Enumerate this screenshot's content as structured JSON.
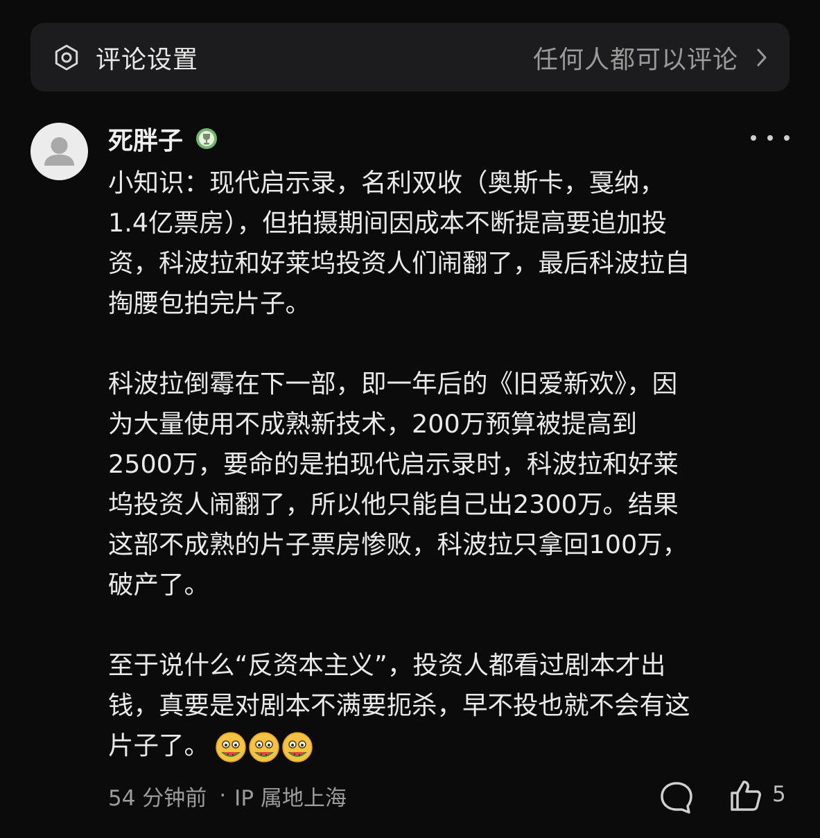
{
  "settings": {
    "icon": "settings-gear-icon",
    "label": "评论设置",
    "value": "任何人都可以评论",
    "chevron_icon": "chevron-right-icon"
  },
  "comment": {
    "avatar_icon": "default-user-avatar",
    "username": "死胖子",
    "badge_icon": "trophy-badge-icon",
    "more_icon": "more-dots-icon",
    "paragraphs": [
      [
        "小知识：现代启示录，名利双收（奥斯卡，戛纳，",
        "1.4亿票房），但拍摄期间因成本不断提高要追加投",
        "资，科波拉和好莱坞投资人们闹翻了，最后科波拉自",
        "掏腰包拍完片子。"
      ],
      [
        "科波拉倒霉在下一部，即一年后的《旧爱新欢》，因",
        "为大量使用不成熟新技术，200万预算被提高到",
        "2500万，要命的是拍现代启示录时，科波拉和好莱",
        "坞投资人闹翻了，所以他只能自己出2300万。结果",
        "这部不成熟的片子票房惨败，科波拉只拿回100万，",
        "破产了。"
      ],
      [
        "至于说什么“反资本主义”，投资人都看过剧本才出",
        "钱，真要是对剧本不满要扼杀，早不投也就不会有这",
        "片子了。"
      ]
    ],
    "emojis": [
      "melon-eating-emoji",
      "melon-eating-emoji",
      "melon-eating-emoji"
    ],
    "time": "54 分钟前",
    "separator": "·",
    "location": "IP 属地上海",
    "reply_icon": "comment-bubble-icon",
    "like_icon": "thumbs-up-icon",
    "like_count": "5"
  },
  "colors": {
    "background": "#0b0b0b",
    "card": "#1c1c1e",
    "text_primary": "#e9e9e9",
    "text_secondary": "#9c9c9c"
  }
}
